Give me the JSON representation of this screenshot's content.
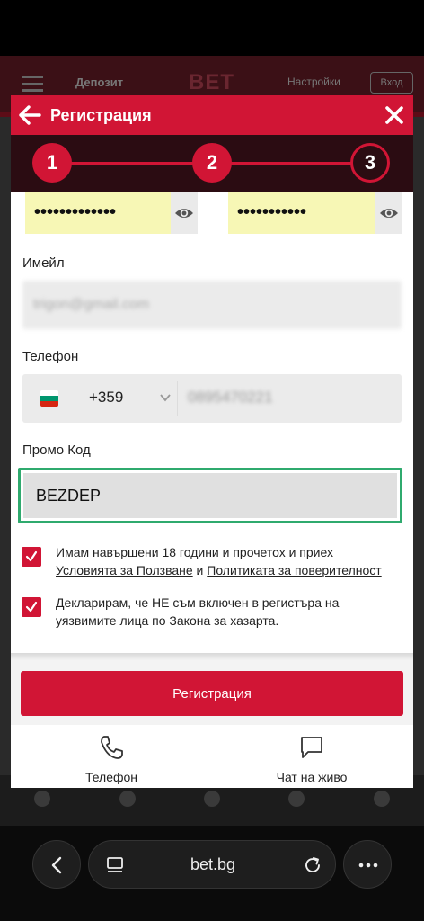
{
  "background_site": {
    "deposit_label": "Депозит",
    "logo_text": "BET",
    "login_label": "Настройки",
    "register_label": "Вход"
  },
  "modal": {
    "title": "Регистрация",
    "steps": [
      "1",
      "2",
      "3"
    ],
    "current_step": 3,
    "password_mask": "•••••••••••••",
    "confirm_password_mask": "•••••••••••",
    "email": {
      "label": "Имейл",
      "value": "trigon@gmail.com"
    },
    "phone": {
      "label": "Телефон",
      "country_code": "+359",
      "country": "Bulgaria",
      "value": "0895470221"
    },
    "promo": {
      "label": "Промо Код",
      "value": "BEZDEP"
    },
    "agreements": [
      {
        "checked": true,
        "text_before": "Имам навършени 18 години и прочетох и приех",
        "link1": "Условията за Ползване",
        "joiner": "и",
        "link2": "Политиката за поверителност"
      },
      {
        "checked": true,
        "text": "Декларирам, че НЕ съм включен в регистъра на уязвимите лица по Закона за хазарта."
      }
    ],
    "register_button": "Регистрация",
    "support": {
      "phone_label": "Телефон",
      "chat_label": "Чат на живо"
    }
  },
  "browser": {
    "url": "bet.bg"
  },
  "colors": {
    "brand_red": "#d11535",
    "stepper_bg": "#2b0c12",
    "password_fill": "#f7f7b5",
    "promo_focus": "#2faa6e"
  }
}
